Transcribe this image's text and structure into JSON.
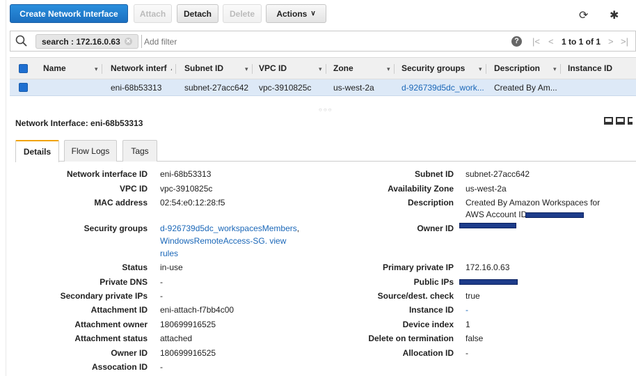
{
  "toolbar": {
    "create_label": "Create Network Interface",
    "attach_label": "Attach",
    "detach_label": "Detach",
    "delete_label": "Delete",
    "actions_label": "Actions",
    "refresh_icon": "refresh-icon",
    "settings_icon": "gear-icon"
  },
  "filter": {
    "chip_label": "search : 172.16.0.63",
    "placeholder": "Add filter",
    "pagination_text": "1 to 1 of 1"
  },
  "table": {
    "headers": {
      "name": "Name",
      "network_interface": "Network interf",
      "subnet_id": "Subnet ID",
      "vpc_id": "VPC ID",
      "zone": "Zone",
      "security_groups": "Security groups",
      "description": "Description",
      "instance_id": "Instance ID"
    },
    "row": {
      "name": "",
      "network_interface": "eni-68b53313",
      "subnet_id": "subnet-27acc642",
      "vpc_id": "vpc-3910825c",
      "zone": "us-west-2a",
      "security_groups": "d-926739d5dc_work...",
      "description": "Created By Am...",
      "instance_id": ""
    }
  },
  "panel": {
    "title": "Network Interface: eni-68b53313",
    "tabs": [
      "Details",
      "Flow Logs",
      "Tags"
    ]
  },
  "details_left": {
    "network_interface_id": {
      "label": "Network interface ID",
      "value": "eni-68b53313"
    },
    "vpc_id": {
      "label": "VPC ID",
      "value": "vpc-3910825c"
    },
    "mac_address": {
      "label": "MAC address",
      "value": "02:54:e0:12:28:f5"
    },
    "security_groups": {
      "label": "Security groups",
      "value1": "d-926739d5dc_workspacesMembers",
      "sep1": ",",
      "value2": "WindowsRemoteAccess-SG",
      "sep2": ". view",
      "value3": "rules"
    },
    "status": {
      "label": "Status",
      "value": "in-use"
    },
    "private_dns": {
      "label": "Private DNS",
      "value": "-"
    },
    "secondary_private_ips": {
      "label": "Secondary private IPs",
      "value": "-"
    },
    "attachment_id": {
      "label": "Attachment ID",
      "value": "eni-attach-f7bb4c00"
    },
    "attachment_owner": {
      "label": "Attachment owner",
      "value": "180699916525"
    },
    "attachment_status": {
      "label": "Attachment status",
      "value": "attached"
    },
    "owner_id": {
      "label": "Owner ID",
      "value": "180699916525"
    },
    "association_id": {
      "label": "Assocation ID",
      "value": "-"
    }
  },
  "details_right": {
    "subnet_id": {
      "label": "Subnet ID",
      "value": "subnet-27acc642"
    },
    "availability_zone": {
      "label": "Availability Zone",
      "value": "us-west-2a"
    },
    "description": {
      "label": "Description",
      "value1": "Created By Amazon Workspaces for",
      "value2": "AWS Account ID"
    },
    "owner_id": {
      "label": "Owner ID",
      "value": ""
    },
    "primary_private_ip": {
      "label": "Primary private IP",
      "value": "172.16.0.63"
    },
    "public_ips": {
      "label": "Public IPs",
      "value": ""
    },
    "source_dest_check": {
      "label": "Source/dest. check",
      "value": "true"
    },
    "instance_id": {
      "label": "Instance ID",
      "value": "-"
    },
    "device_index": {
      "label": "Device index",
      "value": "1"
    },
    "delete_on_termination": {
      "label": "Delete on termination",
      "value": "false"
    },
    "allocation_id": {
      "label": "Allocation ID",
      "value": "-"
    }
  }
}
